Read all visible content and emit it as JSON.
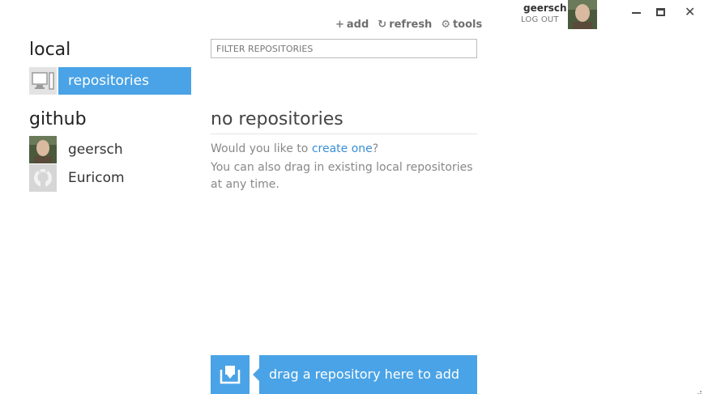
{
  "window": {
    "minimize_icon": "minimize-icon",
    "maximize_icon": "maximize-icon",
    "close_glyph": "✕"
  },
  "user": {
    "name": "geersch",
    "logout_label": "LOG OUT"
  },
  "toolbar": {
    "add": {
      "icon": "+",
      "label": "add"
    },
    "refresh": {
      "icon": "↻",
      "label": "refresh"
    },
    "tools": {
      "icon": "⚙",
      "label": "tools"
    }
  },
  "sidebar": {
    "local": {
      "title": "local",
      "items": [
        {
          "label": "repositories",
          "icon": "computer-icon",
          "selected": true
        }
      ]
    },
    "github": {
      "title": "github",
      "items": [
        {
          "label": "geersch",
          "icon": "user-avatar"
        },
        {
          "label": "Euricom",
          "icon": "octocat-icon"
        }
      ]
    }
  },
  "filter": {
    "placeholder": "FILTER REPOSITORIES",
    "value": ""
  },
  "empty_state": {
    "title": "no repositories",
    "line1_prefix": "Would you like to ",
    "line1_link": "create one",
    "line1_suffix": "?",
    "line2": "You can also drag in existing local repositories at any time."
  },
  "dropzone": {
    "icon": "drop-repository-icon",
    "label": "drag a repository here to add"
  },
  "colors": {
    "accent": "#4aa3e6",
    "link": "#3a8fd6"
  }
}
